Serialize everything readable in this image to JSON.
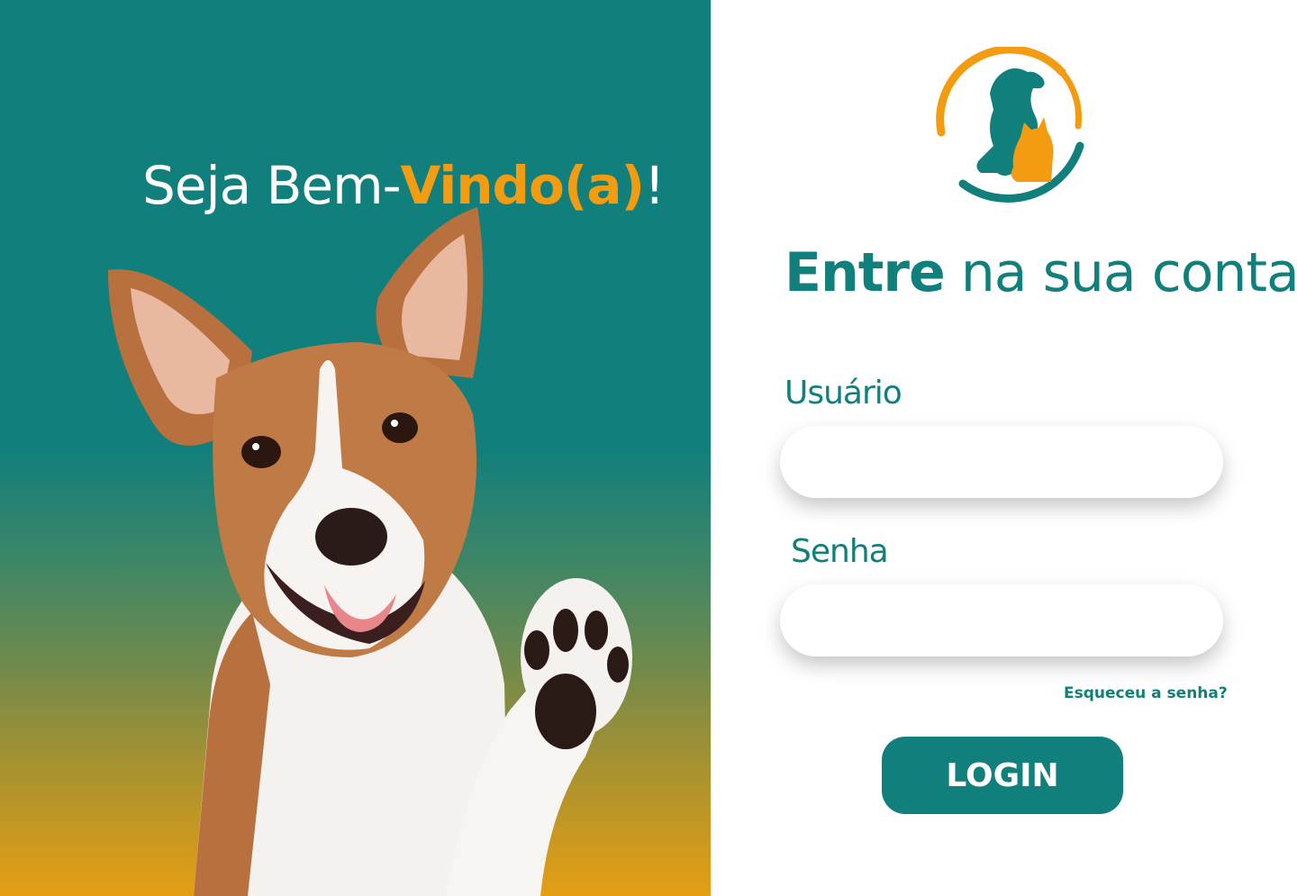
{
  "welcome": {
    "prefix": "Seja Bem-",
    "highlight": "Vindo(a)",
    "suffix": "!"
  },
  "signin": {
    "title_bold": "Entre",
    "title_rest": " na sua conta"
  },
  "form": {
    "username_label": "Usuário",
    "username_value": "",
    "password_label": "Senha",
    "password_value": "",
    "forgot_link": "Esqueceu a senha?",
    "login_button": "LOGIN"
  },
  "colors": {
    "teal": "#117f7b",
    "orange": "#f39c12",
    "white": "#ffffff"
  },
  "icons": {
    "logo": "dog-cat-logo-icon",
    "hero": "waving-dog-illustration"
  }
}
